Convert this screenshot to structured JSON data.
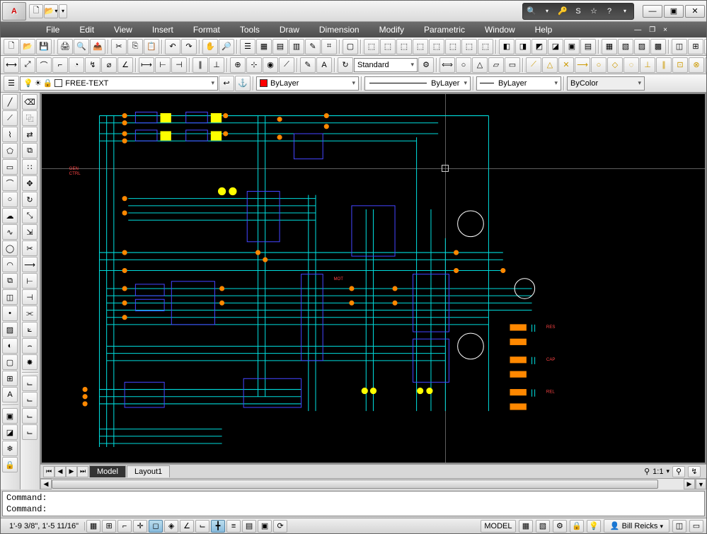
{
  "app": {
    "logo": "A"
  },
  "qat": {
    "new": "🗋",
    "open": "📂"
  },
  "search_icons": {
    "binoc": "🔍",
    "key": "🔑",
    "s": "S",
    "star": "☆",
    "help": "?"
  },
  "win_btns": {
    "min": "—",
    "max": "▣",
    "close": "✕"
  },
  "menu": [
    "File",
    "Edit",
    "View",
    "Insert",
    "Format",
    "Tools",
    "Draw",
    "Dimension",
    "Modify",
    "Parametric",
    "Window",
    "Help"
  ],
  "mdi": {
    "min": "—",
    "max": "❐",
    "close": "×"
  },
  "toolbar2": {
    "text_style": "Standard"
  },
  "props": {
    "layer": {
      "value": "FREE-TEXT",
      "swatch": "#ffffff"
    },
    "color": {
      "value": "ByLayer",
      "swatch": "#ff0000"
    },
    "linetype": {
      "value": "ByLayer"
    },
    "lineweight": {
      "value": "ByLayer"
    },
    "plotstyle": {
      "value": "ByColor"
    }
  },
  "tabs": {
    "model": "Model",
    "layout1": "Layout1"
  },
  "tabs_status": {
    "scale": "1:1",
    "icon": "⚲"
  },
  "cmd": {
    "prompt1": "Command:",
    "prompt2": "Command:"
  },
  "status": {
    "coords": "1'-9 3/8\",   1'-5 11/16\"",
    "model_btn": "MODEL",
    "user": "Bill Reicks"
  },
  "layer_icons": {
    "bulb": "💡",
    "sun": "☀",
    "lock": "🔒"
  }
}
